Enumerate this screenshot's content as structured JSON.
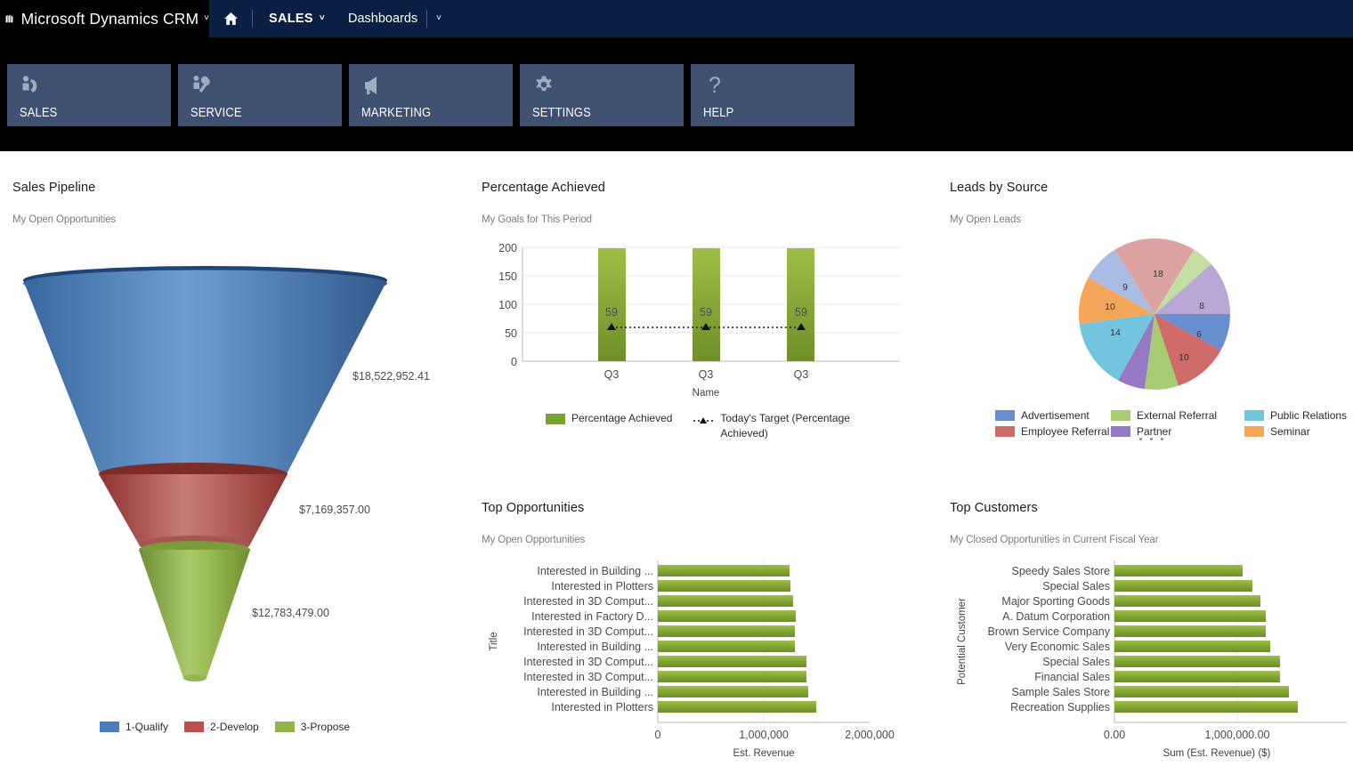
{
  "header": {
    "brand": "Microsoft Dynamics CRM",
    "brand_caret": "˅",
    "logo_icon": "dynamics-logo-icon",
    "home_icon": "home-icon",
    "module_label": "SALES",
    "module_caret": "˅",
    "page_label": "Dashboards",
    "page_caret": "˅",
    "bar_color": "#0a1f44",
    "bg_color": "#000000"
  },
  "tiles": [
    {
      "label": "SALES",
      "icon": "person-phone-icon"
    },
    {
      "label": "SERVICE",
      "icon": "person-wrench-icon"
    },
    {
      "label": "MARKETING",
      "icon": "megaphone-icon"
    },
    {
      "label": "SETTINGS",
      "icon": "gear-icon"
    },
    {
      "label": "HELP",
      "icon": "question-mark-icon"
    }
  ],
  "tile_color": "#3f5170",
  "widgets": {
    "sales_pipeline": {
      "title": "Sales Pipeline",
      "subtitle": "My Open Opportunities"
    },
    "percentage_achieved": {
      "title": "Percentage Achieved",
      "subtitle": "My Goals for This Period"
    },
    "leads_by_source": {
      "title": "Leads by Source",
      "subtitle": "My Open Leads"
    },
    "top_opportunities": {
      "title": "Top Opportunities",
      "subtitle": "My Open Opportunities"
    },
    "top_customers": {
      "title": "Top Customers",
      "subtitle": "My Closed Opportunities in Current Fiscal Year"
    }
  },
  "chart_data": [
    {
      "type": "funnel",
      "title": "Sales Pipeline",
      "subtitle": "My Open Opportunities",
      "categories": [
        "1-Qualify",
        "2-Develop",
        "3-Propose"
      ],
      "values": [
        18522952.41,
        7169357.0,
        12783479.0
      ],
      "labels": [
        "$18,522,952.41",
        "$7,169,357.00",
        "$12,783,479.00"
      ],
      "colors": [
        "#4a7ebb",
        "#bf4f4a",
        "#8fb54a"
      ],
      "legend": [
        "1-Qualify",
        "2-Develop",
        "3-Propose"
      ],
      "legend_position": "bottom"
    },
    {
      "type": "bar",
      "title": "Percentage Achieved",
      "subtitle": "My Goals for This Period",
      "categories": [
        "Q3",
        "Q3",
        "Q3"
      ],
      "values": [
        198,
        198,
        198
      ],
      "series": [
        {
          "name": "Percentage Achieved",
          "values": [
            198,
            198,
            198
          ],
          "color": "#7aa22e"
        },
        {
          "name": "Today's Target (Percentage Achieved)",
          "values": [
            59,
            59,
            59
          ],
          "color": "#000000",
          "style": "dotted-line-marker"
        }
      ],
      "point_labels": [
        "59",
        "59",
        "59"
      ],
      "xlabel": "Name",
      "ylabel": "",
      "ylim": [
        0,
        200
      ],
      "yticks": [
        0,
        50,
        100,
        150,
        200
      ],
      "ytick_labels": [
        "0",
        "50",
        "100",
        "150",
        "200"
      ],
      "grid": true,
      "legend": [
        "Percentage Achieved",
        "Today's Target (Percentage Achieved)"
      ],
      "legend_position": "bottom"
    },
    {
      "type": "pie",
      "title": "Leads by Source",
      "subtitle": "My Open Leads",
      "slices": [
        {
          "label": "Advertisement",
          "value": 6,
          "color": "#6a8fd0",
          "show_label": true
        },
        {
          "label": "Employee Referral",
          "value": 10,
          "color": "#cf6b68",
          "show_label": true
        },
        {
          "label": "External Referral",
          "value": 9,
          "color": "#a8cc72",
          "show_label": false
        },
        {
          "label": "Partner",
          "value": 6,
          "color": "#9579c4",
          "show_label": false
        },
        {
          "label": "Public Relations",
          "value": 14,
          "color": "#72c5dc",
          "show_label": true
        },
        {
          "label": "Seminar",
          "value": 10,
          "color": "#f9a council",
          "show_label": true
        },
        {
          "label": "Advertisement",
          "value": 9,
          "color": "#a9bde4",
          "show_label": true
        },
        {
          "label": "Employee Referral",
          "value": 18,
          "color": "#dda3a3",
          "show_label": true
        },
        {
          "label": "External Referral",
          "value": 5,
          "color": "#c5dfa3",
          "show_label": false
        },
        {
          "label": "Partner",
          "value": 8,
          "color": "#b9a7d5",
          "show_label": true
        }
      ],
      "legend": [
        "Advertisement",
        "External Referral",
        "Public Relations",
        "Employee Referral",
        "Partner",
        "Seminar"
      ],
      "legend_colors": [
        "#6a8fd0",
        "#a8cc72",
        "#72c5dc",
        "#cf6b68",
        "#9579c4",
        "#f5a65b"
      ],
      "legend_position": "bottom"
    },
    {
      "type": "bar",
      "orientation": "horizontal",
      "title": "Top Opportunities",
      "subtitle": "My Open Opportunities",
      "categories": [
        "Interested in Building ...",
        "Interested in Plotters",
        "Interested in 3D Comput...",
        "Interested in Factory D...",
        "Interested in 3D Comput...",
        "Interested in Building ...",
        "Interested in 3D Comput...",
        "Interested in 3D Comput...",
        "Interested in Building ...",
        "Interested in Plotters"
      ],
      "values": [
        1240000,
        1250000,
        1280000,
        1300000,
        1295000,
        1295000,
        1400000,
        1400000,
        1420000,
        1490000
      ],
      "bar_color": "#7aa22e",
      "xlabel": "Est. Revenue",
      "ylabel": "Title",
      "xlim": [
        0,
        2000000
      ],
      "xticks": [
        0,
        1000000,
        2000000
      ],
      "xtick_labels": [
        "0",
        "1,000,000",
        "2,000,000"
      ],
      "grid": true
    },
    {
      "type": "bar",
      "orientation": "horizontal",
      "title": "Top Customers",
      "subtitle": "My Closed Opportunities in Current Fiscal Year",
      "categories": [
        "Speedy Sales Store",
        "Special Sales",
        "Major Sporting Goods",
        "A. Datum Corporation",
        "Brown Service Company",
        "Very Economic Sales",
        "Special Sales",
        "Financial Sales",
        "Sample Sales Store",
        "Recreation Supplies"
      ],
      "values": [
        1040000,
        1120000,
        1190000,
        1230000,
        1230000,
        1270000,
        1350000,
        1350000,
        1420000,
        1490000
      ],
      "bar_color": "#7aa22e",
      "xlabel": "Sum (Est. Revenue) ($)",
      "ylabel": "Potential Customer",
      "xlim": [
        0,
        1600000
      ],
      "xticks": [
        0,
        1000000
      ],
      "xtick_labels": [
        "0.00",
        "1,000,000.00"
      ],
      "grid": true
    }
  ]
}
